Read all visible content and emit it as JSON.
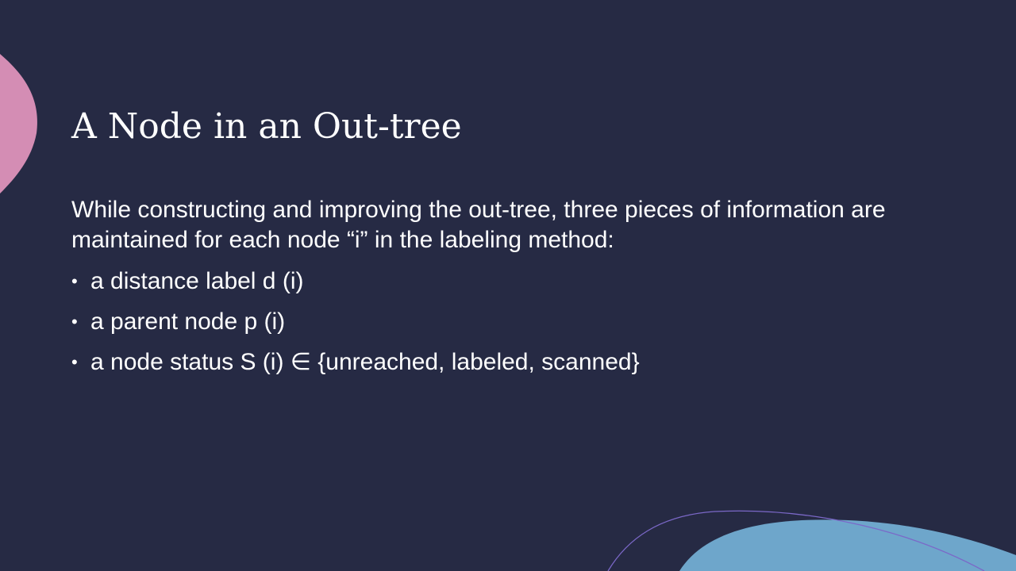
{
  "slide": {
    "title": "A Node in an Out-tree",
    "intro": "While constructing and improving the out-tree, three pieces of information are maintained for each node “i” in the labeling method:",
    "bullets": [
      "a distance label d (i)",
      "a parent node p (i)",
      "a node status S (i) ∈ {unreached, labeled, scanned}"
    ]
  },
  "colors": {
    "background": "#262a44",
    "accent_pink": "#d48db4",
    "accent_blue": "#6ea6cb",
    "accent_line": "#7b68c8",
    "text": "#ffffff"
  }
}
